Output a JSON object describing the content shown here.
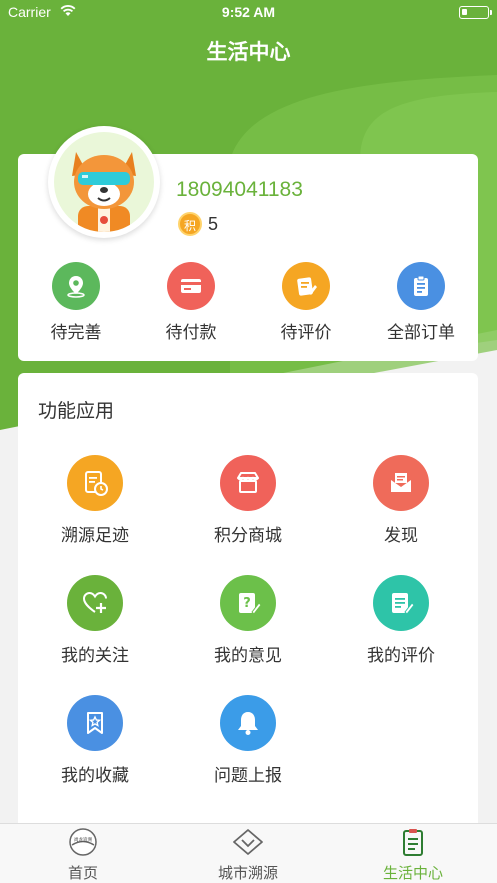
{
  "status": {
    "carrier": "Carrier",
    "time": "9:52 AM"
  },
  "nav": {
    "title": "生活中心"
  },
  "profile": {
    "phone": "18094041183",
    "points_badge": "积",
    "points": "5"
  },
  "orders": [
    {
      "label": "待完善",
      "icon": "location-pin-icon",
      "color": "#5cb85c"
    },
    {
      "label": "待付款",
      "icon": "card-icon",
      "color": "#f0625a"
    },
    {
      "label": "待评价",
      "icon": "note-edit-icon",
      "color": "#f5a623"
    },
    {
      "label": "全部订单",
      "icon": "clipboard-icon",
      "color": "#4a90e2"
    }
  ],
  "functions": {
    "title": "功能应用",
    "items": [
      {
        "label": "溯源足迹",
        "icon": "trace-history-icon",
        "color": "#f5a623"
      },
      {
        "label": "积分商城",
        "icon": "store-icon",
        "color": "#f0625a"
      },
      {
        "label": "发现",
        "icon": "envelope-icon",
        "color": "#ef6b5a"
      },
      {
        "label": "我的关注",
        "icon": "heart-plus-icon",
        "color": "#6ab23b"
      },
      {
        "label": "我的意见",
        "icon": "question-note-icon",
        "color": "#6cc04a"
      },
      {
        "label": "我的评价",
        "icon": "review-note-icon",
        "color": "#2ec4a8"
      },
      {
        "label": "我的收藏",
        "icon": "bookmark-star-icon",
        "color": "#4a90e2"
      },
      {
        "label": "问题上报",
        "icon": "bell-icon",
        "color": "#3b9ce8"
      }
    ]
  },
  "tabs": [
    {
      "label": "首页",
      "icon": "home-logo-icon",
      "logo_text": "尚龙追溯"
    },
    {
      "label": "城市溯源",
      "icon": "diamond-chevron-icon"
    },
    {
      "label": "生活中心",
      "icon": "clipboard-check-icon"
    }
  ]
}
